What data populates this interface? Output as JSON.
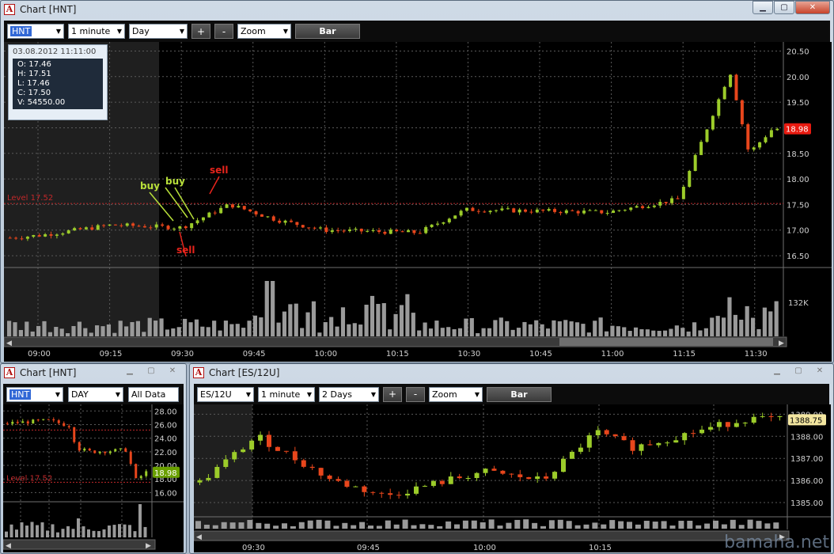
{
  "main": {
    "title": "Chart [HNT]",
    "symbol": "HNT",
    "interval": "1 minute",
    "range": "Day",
    "plus": "+",
    "minus": "-",
    "zoom": "Zoom",
    "mode": "Bar",
    "info": {
      "time": "03.08.2012 11:11:00",
      "o": "O: 17.46",
      "h": "H: 17.51",
      "l": "L: 17.46",
      "c": "C: 17.50",
      "v": "V: 54550.00"
    },
    "level_label": "Level 17.52",
    "annotations": [
      "buy",
      "buy",
      "sell",
      "sell"
    ],
    "time_labels": [
      "09:00",
      "09:15",
      "09:30",
      "09:45",
      "10:00",
      "10:15",
      "10:30",
      "10:45",
      "11:00",
      "11:15",
      "11:30"
    ],
    "price_labels": [
      "20.50",
      "20.00",
      "19.50",
      "19.00",
      "18.50",
      "18.00",
      "17.50",
      "17.00",
      "16.50"
    ],
    "last_price": "18.98",
    "volume_label": "132K",
    "colors": {
      "up": "#9ccc2a",
      "down": "#e8461c",
      "level": "#c0282a"
    }
  },
  "daily": {
    "title": "Chart [HNT]",
    "symbol": "HNT",
    "interval": "DAY",
    "range": "All Data",
    "level_label": "Level 17.52",
    "price_labels": [
      "28.00",
      "26.00",
      "24.00",
      "22.00",
      "20.00",
      "18.00",
      "16.00"
    ],
    "last_price": "18.98"
  },
  "es": {
    "title": "Chart [ES/12U]",
    "symbol": "ES/12U",
    "interval": "1 minute",
    "range": "2 Days",
    "plus": "+",
    "minus": "-",
    "zoom": "Zoom",
    "mode": "Bar",
    "time_labels": [
      "09:30",
      "09:45",
      "10:00",
      "10:15"
    ],
    "price_labels": [
      "1389.00",
      "1388.00",
      "1387.00",
      "1386.00",
      "1385.00"
    ],
    "last_price": "1388.75"
  },
  "watermark": "bamaha.net",
  "chart_data": [
    {
      "type": "candlestick",
      "title": "Chart [HNT]",
      "interval": "1 minute",
      "ylim": [
        16.3,
        20.6
      ],
      "level": 17.52,
      "x_range": [
        "09:00",
        "11:36"
      ],
      "close_approx": [
        {
          "t": "09:00",
          "c": 16.9
        },
        {
          "t": "09:15",
          "c": 17.1
        },
        {
          "t": "09:30",
          "c": 17.05
        },
        {
          "t": "09:40",
          "c": 17.5
        },
        {
          "t": "09:50",
          "c": 17.2
        },
        {
          "t": "10:00",
          "c": 17.0
        },
        {
          "t": "10:20",
          "c": 16.95
        },
        {
          "t": "10:30",
          "c": 17.4
        },
        {
          "t": "11:00",
          "c": 17.35
        },
        {
          "t": "11:15",
          "c": 17.6
        },
        {
          "t": "11:26",
          "c": 20.1
        },
        {
          "t": "11:30",
          "c": 18.5
        },
        {
          "t": "11:35",
          "c": 18.98
        }
      ],
      "last": 18.98,
      "volume_tick": "132K"
    },
    {
      "type": "candlestick",
      "title": "Chart [HNT]",
      "interval": "DAY",
      "ylim": [
        15,
        28.5
      ],
      "level": 17.52,
      "last": 18.98
    },
    {
      "type": "candlestick",
      "title": "Chart [ES/12U]",
      "interval": "1 minute",
      "ylim": [
        1384.5,
        1389.3
      ],
      "close_approx": [
        {
          "t": "09:22",
          "c": 1385.8
        },
        {
          "t": "09:30",
          "c": 1388.0
        },
        {
          "t": "09:40",
          "c": 1386.0
        },
        {
          "t": "09:47",
          "c": 1385.3
        },
        {
          "t": "10:00",
          "c": 1386.4
        },
        {
          "t": "10:08",
          "c": 1386.0
        },
        {
          "t": "10:15",
          "c": 1388.2
        },
        {
          "t": "10:20",
          "c": 1387.5
        },
        {
          "t": "10:35",
          "c": 1388.8
        }
      ],
      "last": 1388.75
    }
  ]
}
